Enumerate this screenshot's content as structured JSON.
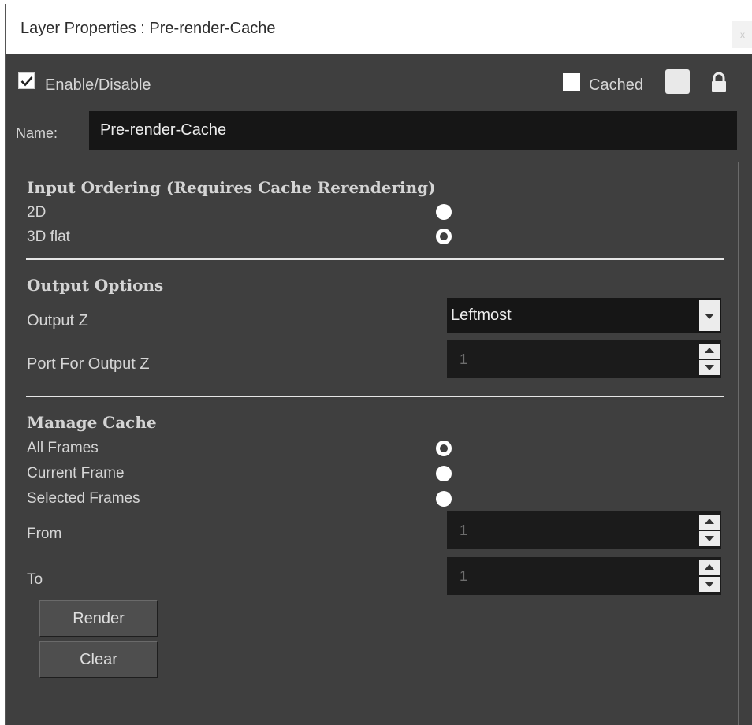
{
  "window": {
    "title": "Layer Properties : Pre-render-Cache",
    "close_glyph": "x"
  },
  "header": {
    "enable_label": "Enable/Disable",
    "enable_checked": true,
    "cached_label": "Cached",
    "cached_checked": false
  },
  "name": {
    "label": "Name:",
    "value": "Pre-render-Cache"
  },
  "input_ordering": {
    "title": "Input Ordering (Requires Cache Rerendering)",
    "options": [
      {
        "label": "2D",
        "selected": false
      },
      {
        "label": "3D flat",
        "selected": true
      }
    ]
  },
  "output_options": {
    "title": "Output Options",
    "output_z_label": "Output Z",
    "output_z_value": "Leftmost",
    "port_label": "Port For Output Z",
    "port_value": "1"
  },
  "manage_cache": {
    "title": "Manage Cache",
    "options": [
      {
        "label": "All Frames",
        "selected": true
      },
      {
        "label": "Current Frame",
        "selected": false
      },
      {
        "label": "Selected Frames",
        "selected": false
      }
    ],
    "from_label": "From",
    "from_value": "1",
    "to_label": "To",
    "to_value": "1",
    "render_label": "Render",
    "clear_label": "Clear"
  }
}
